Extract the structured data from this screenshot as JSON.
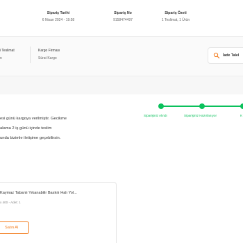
{
  "summary": {
    "order_date_label": "Sipariş Tarihi",
    "order_date_value": "6 Nisan 2024 - 19:58",
    "order_no_label": "Sipariş No",
    "order_no_value": "9158474497",
    "order_summary_label": "Sipariş Özeti",
    "order_summary_value": "1 Teslimat, 1 Ürün"
  },
  "shipment": {
    "delivery_label": "i Teslimat",
    "delivery_value": "n",
    "cargo_label": "Kargo Firması",
    "cargo_value": "Sürat Kargo",
    "return_button": "İade Talel",
    "return_icon": "return-box-icon"
  },
  "tracker": {
    "steps": [
      "Siparişiniz Alındı",
      "Siparişiniz Hazırlanıyor",
      "K"
    ],
    "color": "#0bc15c"
  },
  "message": {
    "lines": [
      "esi günü kargoya verilmiştir. Gecikme",
      "alama 2 iş günü içinde teslim",
      "unda bizimle iletişime geçebilirsin."
    ]
  },
  "product": {
    "name": "Kaymaz Tabanlı Yıkanabilir Baskılı Halı Yol...",
    "meta": "x 400 - Adet: 1",
    "buy_label": "Satın Al",
    "accent": "#f27a1a"
  }
}
